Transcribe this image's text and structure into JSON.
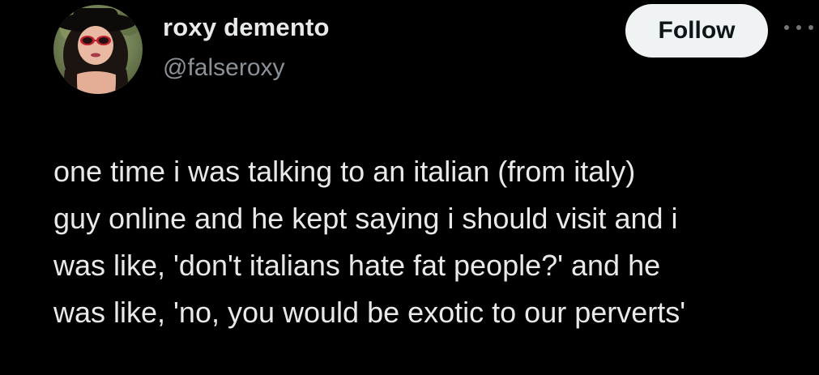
{
  "author": {
    "display_name": "roxy demento",
    "handle": "@falseroxy",
    "avatar_icon": "profile-photo"
  },
  "actions": {
    "follow_label": "Follow",
    "more_icon": "more-options-icon"
  },
  "tweet": {
    "lines": [
      "one time i was talking to an italian (from italy)",
      "guy online and he kept saying i should visit and i",
      "was like, 'don't italians hate fat people?' and he",
      "was like, 'no, you would be exotic to our perverts'"
    ]
  },
  "colors": {
    "background": "#000000",
    "text_primary": "#e7e9ea",
    "text_secondary": "#8b9198",
    "button_bg": "#eff3f4",
    "button_text": "#0f1419"
  }
}
